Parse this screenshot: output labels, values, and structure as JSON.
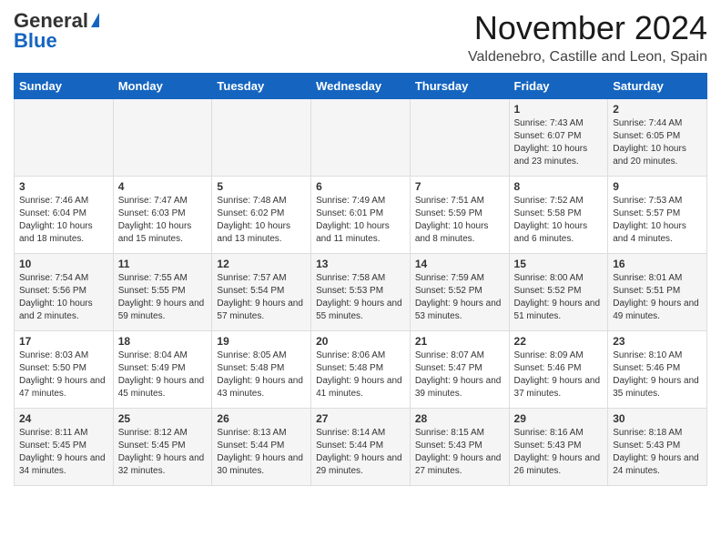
{
  "header": {
    "logo_general": "General",
    "logo_blue": "Blue",
    "month_title": "November 2024",
    "location": "Valdenebro, Castille and Leon, Spain"
  },
  "weekdays": [
    "Sunday",
    "Monday",
    "Tuesday",
    "Wednesday",
    "Thursday",
    "Friday",
    "Saturday"
  ],
  "weeks": [
    [
      {
        "day": "",
        "info": ""
      },
      {
        "day": "",
        "info": ""
      },
      {
        "day": "",
        "info": ""
      },
      {
        "day": "",
        "info": ""
      },
      {
        "day": "",
        "info": ""
      },
      {
        "day": "1",
        "info": "Sunrise: 7:43 AM\nSunset: 6:07 PM\nDaylight: 10 hours and 23 minutes."
      },
      {
        "day": "2",
        "info": "Sunrise: 7:44 AM\nSunset: 6:05 PM\nDaylight: 10 hours and 20 minutes."
      }
    ],
    [
      {
        "day": "3",
        "info": "Sunrise: 7:46 AM\nSunset: 6:04 PM\nDaylight: 10 hours and 18 minutes."
      },
      {
        "day": "4",
        "info": "Sunrise: 7:47 AM\nSunset: 6:03 PM\nDaylight: 10 hours and 15 minutes."
      },
      {
        "day": "5",
        "info": "Sunrise: 7:48 AM\nSunset: 6:02 PM\nDaylight: 10 hours and 13 minutes."
      },
      {
        "day": "6",
        "info": "Sunrise: 7:49 AM\nSunset: 6:01 PM\nDaylight: 10 hours and 11 minutes."
      },
      {
        "day": "7",
        "info": "Sunrise: 7:51 AM\nSunset: 5:59 PM\nDaylight: 10 hours and 8 minutes."
      },
      {
        "day": "8",
        "info": "Sunrise: 7:52 AM\nSunset: 5:58 PM\nDaylight: 10 hours and 6 minutes."
      },
      {
        "day": "9",
        "info": "Sunrise: 7:53 AM\nSunset: 5:57 PM\nDaylight: 10 hours and 4 minutes."
      }
    ],
    [
      {
        "day": "10",
        "info": "Sunrise: 7:54 AM\nSunset: 5:56 PM\nDaylight: 10 hours and 2 minutes."
      },
      {
        "day": "11",
        "info": "Sunrise: 7:55 AM\nSunset: 5:55 PM\nDaylight: 9 hours and 59 minutes."
      },
      {
        "day": "12",
        "info": "Sunrise: 7:57 AM\nSunset: 5:54 PM\nDaylight: 9 hours and 57 minutes."
      },
      {
        "day": "13",
        "info": "Sunrise: 7:58 AM\nSunset: 5:53 PM\nDaylight: 9 hours and 55 minutes."
      },
      {
        "day": "14",
        "info": "Sunrise: 7:59 AM\nSunset: 5:52 PM\nDaylight: 9 hours and 53 minutes."
      },
      {
        "day": "15",
        "info": "Sunrise: 8:00 AM\nSunset: 5:52 PM\nDaylight: 9 hours and 51 minutes."
      },
      {
        "day": "16",
        "info": "Sunrise: 8:01 AM\nSunset: 5:51 PM\nDaylight: 9 hours and 49 minutes."
      }
    ],
    [
      {
        "day": "17",
        "info": "Sunrise: 8:03 AM\nSunset: 5:50 PM\nDaylight: 9 hours and 47 minutes."
      },
      {
        "day": "18",
        "info": "Sunrise: 8:04 AM\nSunset: 5:49 PM\nDaylight: 9 hours and 45 minutes."
      },
      {
        "day": "19",
        "info": "Sunrise: 8:05 AM\nSunset: 5:48 PM\nDaylight: 9 hours and 43 minutes."
      },
      {
        "day": "20",
        "info": "Sunrise: 8:06 AM\nSunset: 5:48 PM\nDaylight: 9 hours and 41 minutes."
      },
      {
        "day": "21",
        "info": "Sunrise: 8:07 AM\nSunset: 5:47 PM\nDaylight: 9 hours and 39 minutes."
      },
      {
        "day": "22",
        "info": "Sunrise: 8:09 AM\nSunset: 5:46 PM\nDaylight: 9 hours and 37 minutes."
      },
      {
        "day": "23",
        "info": "Sunrise: 8:10 AM\nSunset: 5:46 PM\nDaylight: 9 hours and 35 minutes."
      }
    ],
    [
      {
        "day": "24",
        "info": "Sunrise: 8:11 AM\nSunset: 5:45 PM\nDaylight: 9 hours and 34 minutes."
      },
      {
        "day": "25",
        "info": "Sunrise: 8:12 AM\nSunset: 5:45 PM\nDaylight: 9 hours and 32 minutes."
      },
      {
        "day": "26",
        "info": "Sunrise: 8:13 AM\nSunset: 5:44 PM\nDaylight: 9 hours and 30 minutes."
      },
      {
        "day": "27",
        "info": "Sunrise: 8:14 AM\nSunset: 5:44 PM\nDaylight: 9 hours and 29 minutes."
      },
      {
        "day": "28",
        "info": "Sunrise: 8:15 AM\nSunset: 5:43 PM\nDaylight: 9 hours and 27 minutes."
      },
      {
        "day": "29",
        "info": "Sunrise: 8:16 AM\nSunset: 5:43 PM\nDaylight: 9 hours and 26 minutes."
      },
      {
        "day": "30",
        "info": "Sunrise: 8:18 AM\nSunset: 5:43 PM\nDaylight: 9 hours and 24 minutes."
      }
    ]
  ]
}
